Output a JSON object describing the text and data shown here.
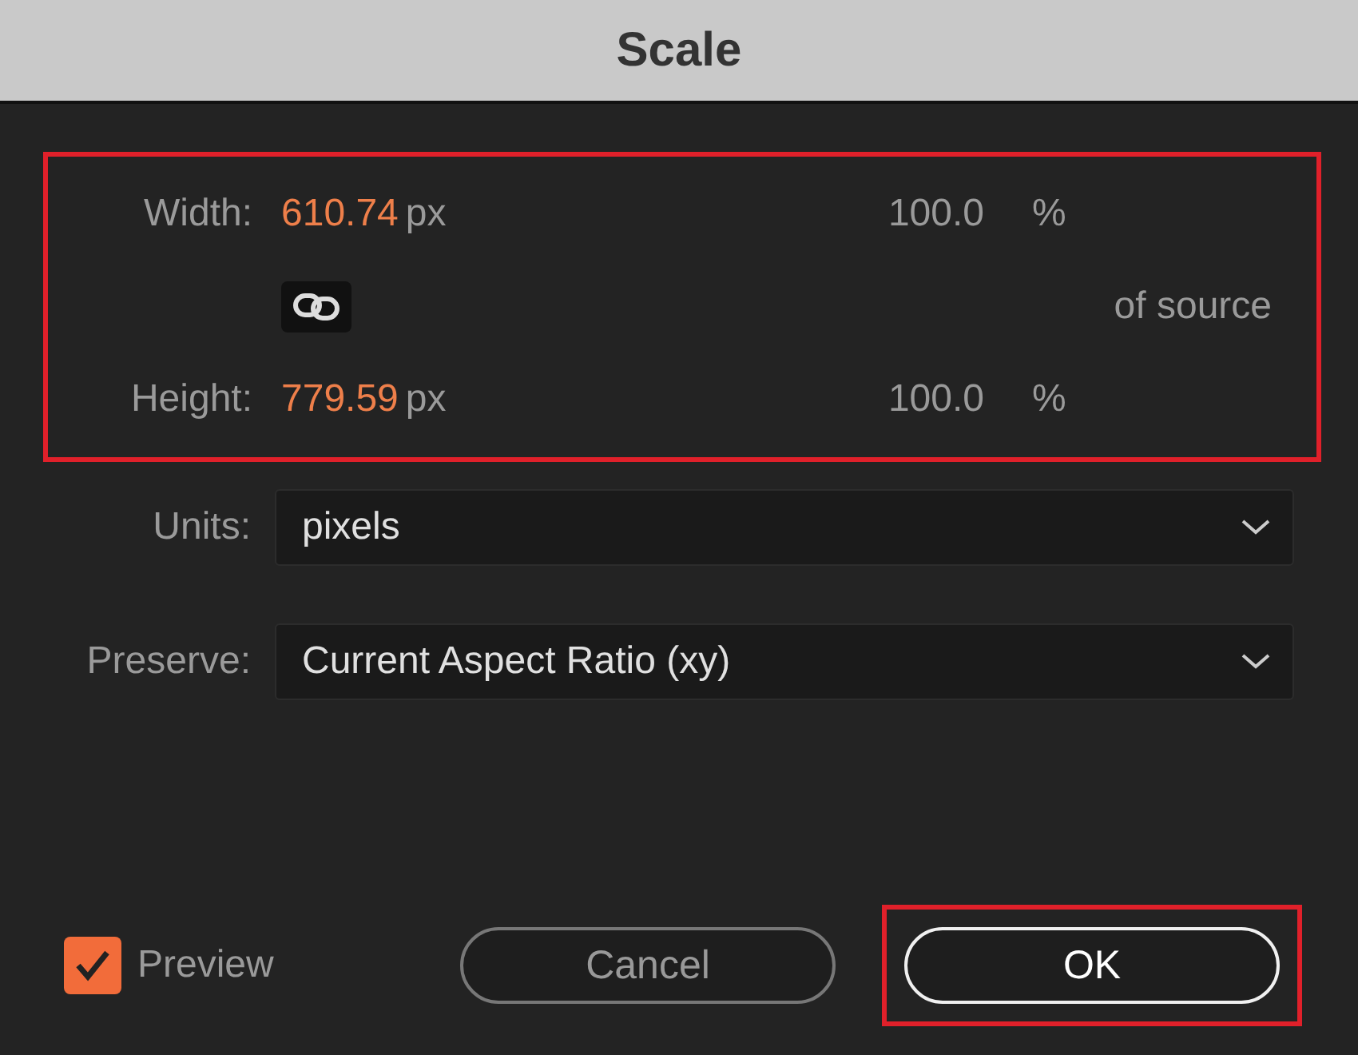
{
  "window": {
    "title": "Scale"
  },
  "dimensions": {
    "highlighted": true,
    "rows": [
      {
        "kind": "value",
        "label": "Width:",
        "value": "610.74",
        "unit": "px",
        "percent": "100.0",
        "percent_unit": "%"
      },
      {
        "kind": "link",
        "linked": true,
        "note": "of source"
      },
      {
        "kind": "value",
        "label": "Height:",
        "value": "779.59",
        "unit": "px",
        "percent": "100.0",
        "percent_unit": "%"
      }
    ]
  },
  "fields": [
    {
      "label": "Units:",
      "value": "pixels"
    },
    {
      "label": "Preserve:",
      "value": "Current Aspect Ratio (xy)"
    }
  ],
  "preview": {
    "label": "Preview",
    "checked": true
  },
  "buttons": [
    {
      "label": "Cancel",
      "primary": false,
      "highlighted": false
    },
    {
      "label": "OK",
      "primary": true,
      "highlighted": true
    }
  ]
}
